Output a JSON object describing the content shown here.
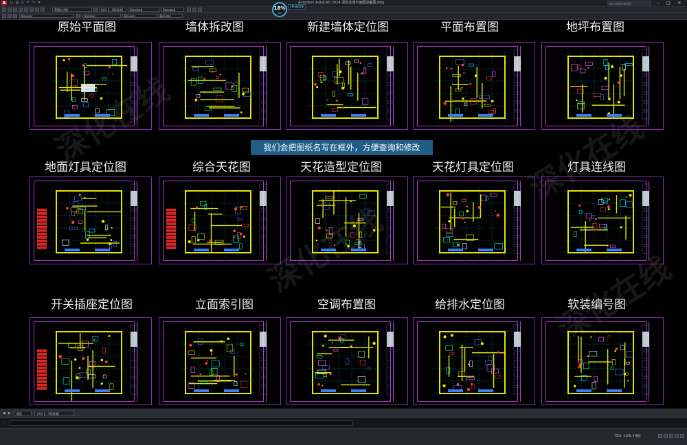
{
  "app": {
    "title": "Autodesk AutoCAD 2014   深圳龙城平面图设备图.dwg",
    "search_placeholder": "输入关键字或短语",
    "logo": "A"
  },
  "quick_access": [
    "□",
    "▤",
    "▢",
    "↶",
    "↷",
    "▾"
  ],
  "window_controls": [
    "–",
    "□",
    "✕"
  ],
  "toolbar": {
    "workspace": "草图与注释",
    "layer": "ByLayer",
    "annotation_scale": "(A3) 1 : 50(标准)",
    "text_style": "Standard",
    "dim_style": "Standard",
    "linetype": "ByLayer",
    "lineweight": "ByLayer",
    "plot_style": "ByColor"
  },
  "network_widget": {
    "value": "18%",
    "unit": "CPU",
    "side_label": "CPU使用率"
  },
  "sheets": [
    {
      "title": "原始平面图"
    },
    {
      "title": "墙体拆改图"
    },
    {
      "title": "新建墙体定位图"
    },
    {
      "title": "平面布置图"
    },
    {
      "title": "地坪布置图"
    },
    {
      "title": "地面灯具定位图"
    },
    {
      "title": "综合天花图"
    },
    {
      "title": "天花造型定位图"
    },
    {
      "title": "天花灯具定位图"
    },
    {
      "title": "灯具连线图"
    },
    {
      "title": "开关插座定位图"
    },
    {
      "title": "立面索引图"
    },
    {
      "title": "空调布置图"
    },
    {
      "title": "给排水定位图"
    },
    {
      "title": "软装编号图"
    }
  ],
  "banner": "我们会把图纸名写在框外，方便查询和修改",
  "watermark": "深化在线",
  "layout_tabs": {
    "controls": [
      "◀",
      "▶"
    ],
    "model": "模型",
    "layout": "(A3) 1 : 50(标准)"
  },
  "command_prompt": "›",
  "status": {
    "coords": "7550, -1200, 0   模型"
  },
  "colors": {
    "frame": "#8b2bb8",
    "banner": "#1f5c86",
    "wall": "#e6e600",
    "grid": "#00ffff"
  }
}
